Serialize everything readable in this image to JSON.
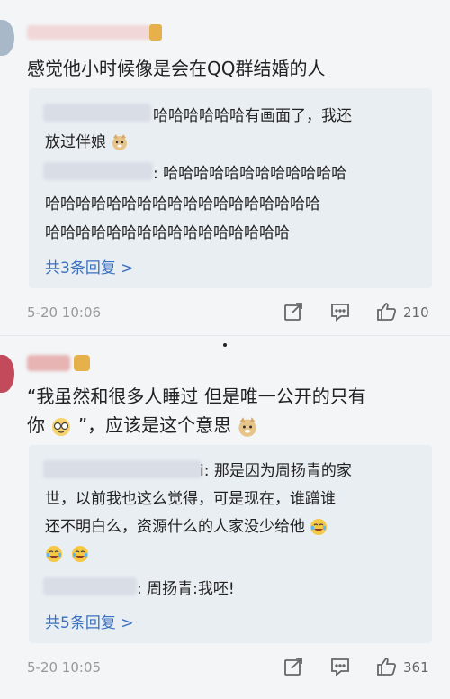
{
  "comments": [
    {
      "text": "感觉他小时候像是会在QQ群结婚的人",
      "replies": [
        {
          "line1": "哈哈哈哈哈哈有画面了，我还",
          "line2": "放过伴娘"
        },
        {
          "line1": ": 哈哈哈哈哈哈哈哈哈哈哈哈",
          "line2": "哈哈哈哈哈哈哈哈哈哈哈哈哈哈哈哈哈哈",
          "line3": "哈哈哈哈哈哈哈哈哈哈哈哈哈哈哈哈"
        }
      ],
      "more_replies": "共3条回复 >",
      "date": "5-20 10:06",
      "likes": "210"
    },
    {
      "text_line1": "“我虽然和很多人睡过 但是唯一公开的只有",
      "text_line2_a": "你",
      "text_line2_b": "”，应该是这个意思",
      "replies": [
        {
          "line1": "i: 那是因为周扬青的家",
          "line2": "世，以前我也这么觉得，可是现在，谁蹭谁",
          "line3": "还不明白么，资源什么的人家没少给他"
        },
        {
          "line1": ": 周扬青:我呸!"
        }
      ],
      "more_replies": "共5条回复 >",
      "date": "5-20 10:05",
      "likes": "361"
    }
  ],
  "icons": {
    "share": "share-icon",
    "comment": "comment-icon",
    "like": "thumb-up-icon",
    "doge": "doge-emoji-icon",
    "laugh_cry": "laugh-cry-emoji-icon",
    "glasses": "glasses-emoji-icon"
  },
  "colors": {
    "link": "#3a70bf",
    "reply_bg": "#e9eef3",
    "meta": "#999999"
  }
}
